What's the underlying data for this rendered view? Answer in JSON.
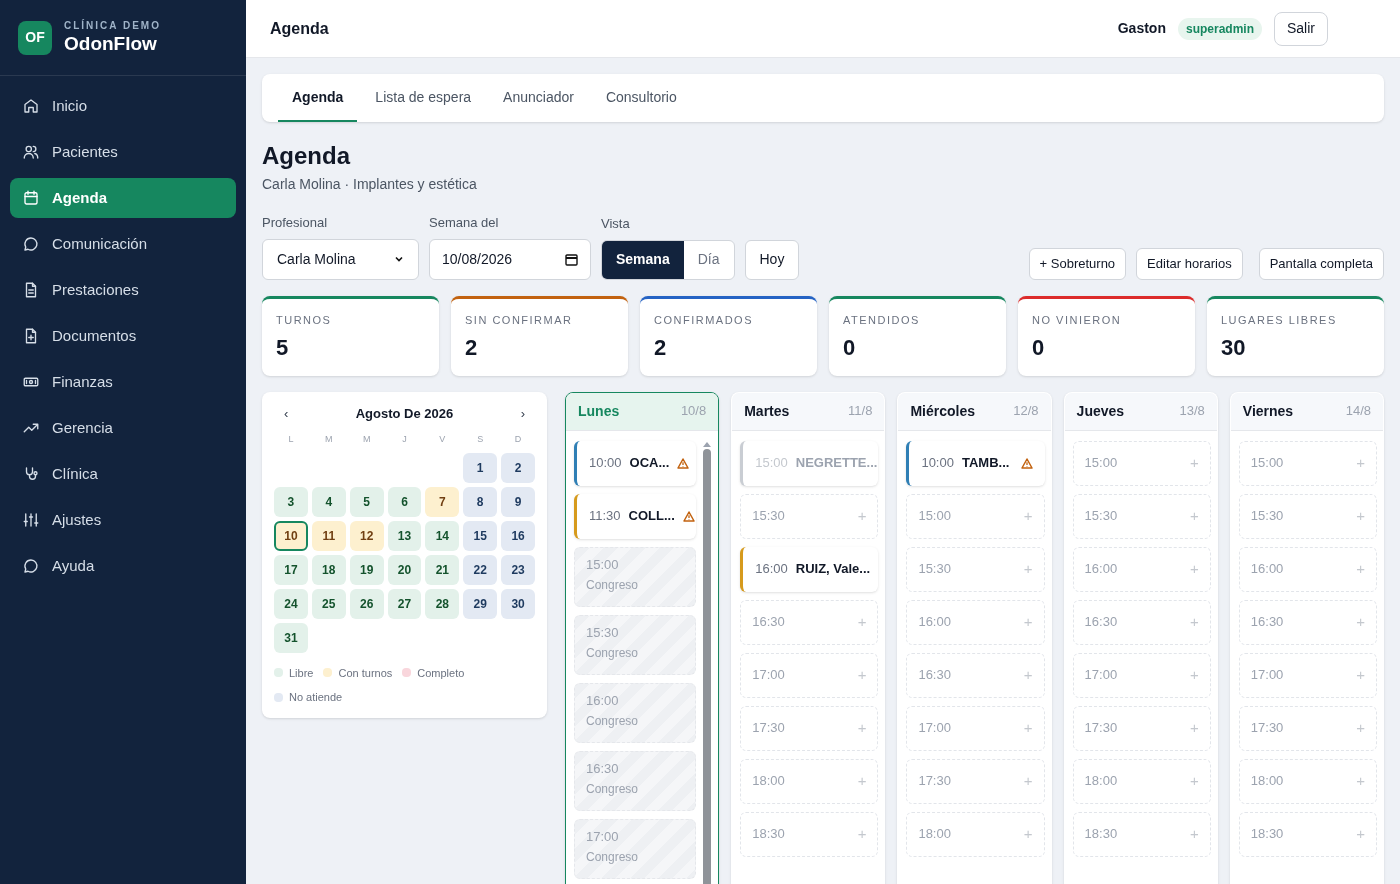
{
  "brand": {
    "logo": "OF",
    "subtitle": "CLÍNICA DEMO",
    "name": "OdonFlow"
  },
  "sidebar": {
    "items": [
      {
        "label": "Inicio",
        "selected": false
      },
      {
        "label": "Pacientes",
        "selected": false
      },
      {
        "label": "Agenda",
        "selected": true
      },
      {
        "label": "Comunicación",
        "selected": false
      },
      {
        "label": "Prestaciones",
        "selected": false
      },
      {
        "label": "Documentos",
        "selected": false
      },
      {
        "label": "Finanzas",
        "selected": false
      },
      {
        "label": "Gerencia",
        "selected": false
      },
      {
        "label": "Clínica",
        "selected": false
      },
      {
        "label": "Ajustes",
        "selected": false
      },
      {
        "label": "Ayuda",
        "selected": false
      }
    ]
  },
  "header": {
    "title": "Agenda",
    "user": "Gaston",
    "role": "superadmin",
    "logout": "Salir"
  },
  "tabs": [
    {
      "label": "Agenda",
      "selected": true
    },
    {
      "label": "Lista de espera",
      "selected": false
    },
    {
      "label": "Anunciador",
      "selected": false
    },
    {
      "label": "Consultorio",
      "selected": false
    }
  ],
  "page": {
    "title": "Agenda",
    "subtitle": "Carla Molina · Implantes y estética"
  },
  "filters": {
    "professional": {
      "label": "Profesional",
      "value": "Carla Molina"
    },
    "week": {
      "label": "Semana del",
      "value": "10/08/2026"
    },
    "view": {
      "label": "Vista",
      "options": [
        {
          "label": "Semana",
          "selected": true
        },
        {
          "label": "Día",
          "selected": false
        }
      ]
    },
    "today": "Hoy"
  },
  "actions": [
    "+ Sobreturno",
    "Editar horarios",
    "Pantalla completa"
  ],
  "stats": [
    {
      "label": "TURNOS",
      "value": "5",
      "color": "#16875f"
    },
    {
      "label": "SIN CONFIRMAR",
      "value": "2",
      "color": "#c2620f"
    },
    {
      "label": "CONFIRMADOS",
      "value": "2",
      "color": "#2563c4"
    },
    {
      "label": "ATENDIDOS",
      "value": "0",
      "color": "#16875f"
    },
    {
      "label": "NO VINIERON",
      "value": "0",
      "color": "#dc2b2b"
    },
    {
      "label": "LUGARES LIBRES",
      "value": "30",
      "color": "#16875f"
    }
  ],
  "calendar": {
    "prev": "‹",
    "title": "Agosto De 2026",
    "next": "›",
    "weekdays": [
      "L",
      "M",
      "M",
      "J",
      "V",
      "S",
      "D"
    ],
    "days": [
      {
        "day": "1",
        "kind": "closed",
        "selected": false
      },
      {
        "day": "2",
        "kind": "closed",
        "selected": false
      },
      {
        "day": "3",
        "kind": "free",
        "selected": false
      },
      {
        "day": "4",
        "kind": "free",
        "selected": false
      },
      {
        "day": "5",
        "kind": "free",
        "selected": false
      },
      {
        "day": "6",
        "kind": "free",
        "selected": false
      },
      {
        "day": "7",
        "kind": "booked",
        "selected": false
      },
      {
        "day": "8",
        "kind": "closed",
        "selected": false
      },
      {
        "day": "9",
        "kind": "closed",
        "selected": false
      },
      {
        "day": "10",
        "kind": "booked",
        "selected": true
      },
      {
        "day": "11",
        "kind": "booked",
        "selected": false
      },
      {
        "day": "12",
        "kind": "booked",
        "selected": false
      },
      {
        "day": "13",
        "kind": "free",
        "selected": false
      },
      {
        "day": "14",
        "kind": "free",
        "selected": false
      },
      {
        "day": "15",
        "kind": "closed",
        "selected": false
      },
      {
        "day": "16",
        "kind": "closed",
        "selected": false
      },
      {
        "day": "17",
        "kind": "free",
        "selected": false
      },
      {
        "day": "18",
        "kind": "free",
        "selected": false
      },
      {
        "day": "19",
        "kind": "free",
        "selected": false
      },
      {
        "day": "20",
        "kind": "free",
        "selected": false
      },
      {
        "day": "21",
        "kind": "free",
        "selected": false
      },
      {
        "day": "22",
        "kind": "closed",
        "selected": false
      },
      {
        "day": "23",
        "kind": "closed",
        "selected": false
      },
      {
        "day": "24",
        "kind": "free",
        "selected": false
      },
      {
        "day": "25",
        "kind": "free",
        "selected": false
      },
      {
        "day": "26",
        "kind": "free",
        "selected": false
      },
      {
        "day": "27",
        "kind": "free",
        "selected": false
      },
      {
        "day": "28",
        "kind": "free",
        "selected": false
      },
      {
        "day": "29",
        "kind": "closed",
        "selected": false
      },
      {
        "day": "30",
        "kind": "closed",
        "selected": false
      },
      {
        "day": "31",
        "kind": "free",
        "selected": false
      }
    ],
    "legend": [
      {
        "label": "Libre",
        "color": "#e3f1ea"
      },
      {
        "label": "Con turnos",
        "color": "#fdf0cf"
      },
      {
        "label": "Completo",
        "color": "#f9d6dc"
      },
      {
        "label": "No atiende",
        "color": "#e3e9f3"
      }
    ]
  },
  "days": [
    {
      "name": "Lunes",
      "date": "10/8",
      "selected": true,
      "slots": [
        {
          "kind": "appointment",
          "time": "10:00",
          "patient": "OCA...",
          "color": "#2f7fb5",
          "muted": false,
          "warning": true
        },
        {
          "kind": "appointment",
          "time": "11:30",
          "patient": "COLL...",
          "color": "#d69a1c",
          "muted": false,
          "warning": true
        },
        {
          "kind": "blocked",
          "time": "15:00",
          "note": "Congreso"
        },
        {
          "kind": "blocked",
          "time": "15:30",
          "note": "Congreso"
        },
        {
          "kind": "blocked",
          "time": "16:00",
          "note": "Congreso"
        },
        {
          "kind": "blocked",
          "time": "16:30",
          "note": "Congreso"
        },
        {
          "kind": "blocked",
          "time": "17:00",
          "note": "Congreso"
        }
      ]
    },
    {
      "name": "Martes",
      "date": "11/8",
      "selected": false,
      "slots": [
        {
          "kind": "appointment",
          "time": "15:00",
          "patient": "NEGRETTE...",
          "color": "#c9cdd3",
          "muted": true,
          "warning": false
        },
        {
          "kind": "free",
          "time": "15:30",
          "add": "+"
        },
        {
          "kind": "appointment",
          "time": "16:00",
          "patient": "RUIZ, Vale...",
          "color": "#d69a1c",
          "muted": false,
          "warning": false
        },
        {
          "kind": "free",
          "time": "16:30",
          "add": "+"
        },
        {
          "kind": "free",
          "time": "17:00",
          "add": "+"
        },
        {
          "kind": "free",
          "time": "17:30",
          "add": "+"
        },
        {
          "kind": "free",
          "time": "18:00",
          "add": "+"
        },
        {
          "kind": "free",
          "time": "18:30",
          "add": "+"
        }
      ]
    },
    {
      "name": "Miércoles",
      "date": "12/8",
      "selected": false,
      "slots": [
        {
          "kind": "appointment",
          "time": "10:00",
          "patient": "TAMB...",
          "color": "#2f7fb5",
          "muted": false,
          "warning": true
        },
        {
          "kind": "free",
          "time": "15:00",
          "add": "+"
        },
        {
          "kind": "free",
          "time": "15:30",
          "add": "+"
        },
        {
          "kind": "free",
          "time": "16:00",
          "add": "+"
        },
        {
          "kind": "free",
          "time": "16:30",
          "add": "+"
        },
        {
          "kind": "free",
          "time": "17:00",
          "add": "+"
        },
        {
          "kind": "free",
          "time": "17:30",
          "add": "+"
        },
        {
          "kind": "free",
          "time": "18:00",
          "add": "+"
        }
      ]
    },
    {
      "name": "Jueves",
      "date": "13/8",
      "selected": false,
      "slots": [
        {
          "kind": "free",
          "time": "15:00",
          "add": "+"
        },
        {
          "kind": "free",
          "time": "15:30",
          "add": "+"
        },
        {
          "kind": "free",
          "time": "16:00",
          "add": "+"
        },
        {
          "kind": "free",
          "time": "16:30",
          "add": "+"
        },
        {
          "kind": "free",
          "time": "17:00",
          "add": "+"
        },
        {
          "kind": "free",
          "time": "17:30",
          "add": "+"
        },
        {
          "kind": "free",
          "time": "18:00",
          "add": "+"
        },
        {
          "kind": "free",
          "time": "18:30",
          "add": "+"
        }
      ]
    },
    {
      "name": "Viernes",
      "date": "14/8",
      "selected": false,
      "slots": [
        {
          "kind": "free",
          "time": "15:00",
          "add": "+"
        },
        {
          "kind": "free",
          "time": "15:30",
          "add": "+"
        },
        {
          "kind": "free",
          "time": "16:00",
          "add": "+"
        },
        {
          "kind": "free",
          "time": "16:30",
          "add": "+"
        },
        {
          "kind": "free",
          "time": "17:00",
          "add": "+"
        },
        {
          "kind": "free",
          "time": "17:30",
          "add": "+"
        },
        {
          "kind": "free",
          "time": "18:00",
          "add": "+"
        },
        {
          "kind": "free",
          "time": "18:30",
          "add": "+"
        }
      ]
    }
  ]
}
